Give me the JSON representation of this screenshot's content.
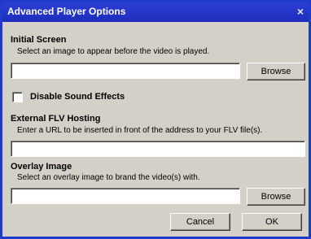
{
  "window": {
    "title": "Advanced Player Options",
    "close_glyph": "×"
  },
  "initial_screen": {
    "heading": "Initial Screen",
    "description": "Select an image to appear before the video is played.",
    "value": "",
    "browse_label": "Browse"
  },
  "sound": {
    "label": "Disable Sound Effects",
    "checked": false
  },
  "flv_hosting": {
    "heading": "External FLV Hosting",
    "description": "Enter a URL to be inserted in front of the address to your FLV file(s).",
    "value": ""
  },
  "overlay": {
    "heading": "Overlay Image",
    "description": "Select an overlay image to brand the video(s) with.",
    "value": "",
    "browse_label": "Browse"
  },
  "actions": {
    "cancel_label": "Cancel",
    "ok_label": "OK"
  },
  "colors": {
    "titlebar": "#1c2dbd",
    "dialog_bg": "#d4d0c8",
    "desktop": "#2a2fc0"
  }
}
